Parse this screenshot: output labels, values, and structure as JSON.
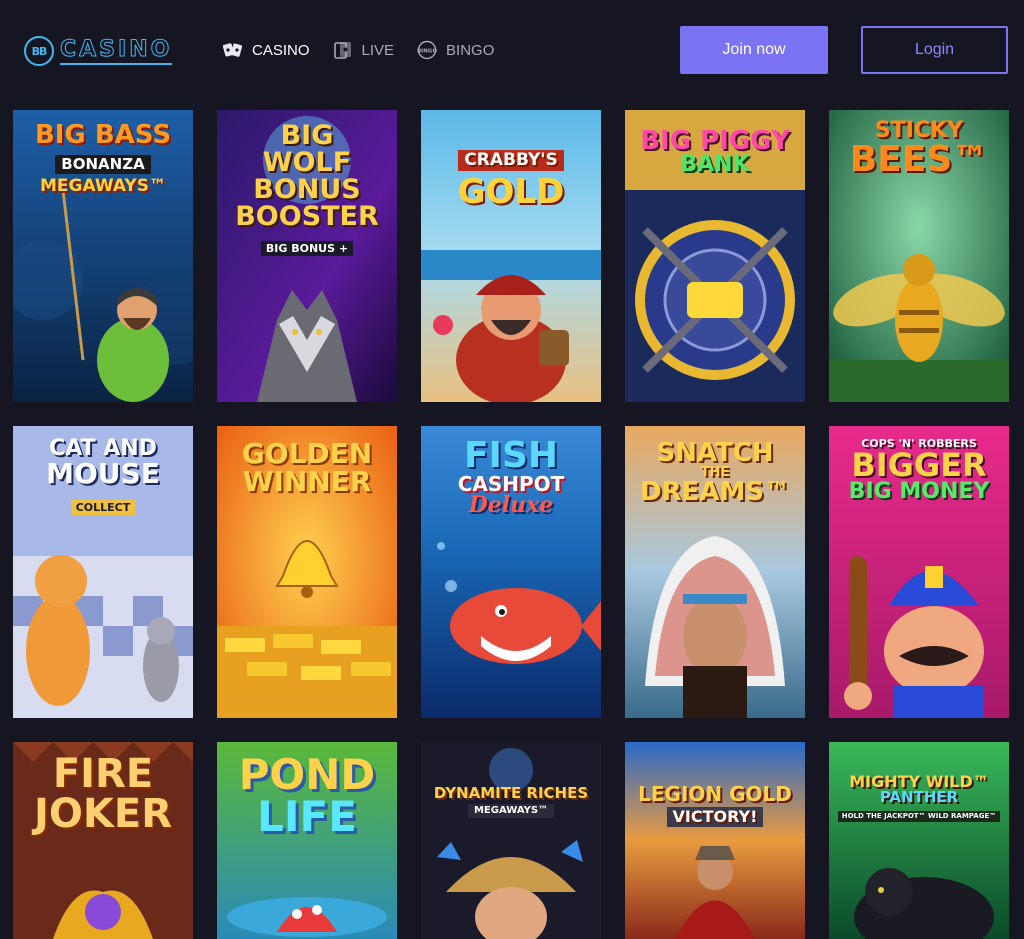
{
  "header": {
    "logo": {
      "badge": "BB",
      "text": "CASINO"
    },
    "nav": [
      {
        "label": "CASINO",
        "icon": "cards-icon",
        "active": true
      },
      {
        "label": "LIVE",
        "icon": "live-cards-icon",
        "active": false
      },
      {
        "label": "BINGO",
        "icon": "bingo-ball-icon",
        "active": false
      }
    ],
    "join_label": "Join now",
    "login_label": "Login"
  },
  "games": [
    {
      "lines": [
        "BIG BASS",
        "BONANZA",
        "MEGAWAYS™"
      ]
    },
    {
      "lines": [
        "BIG",
        "WOLF",
        "BONUS",
        "BOOSTER",
        "BIG BONUS +"
      ]
    },
    {
      "lines": [
        "CRABBY'S",
        "GOLD"
      ]
    },
    {
      "lines": [
        "BIG PIGGY",
        "BANK"
      ]
    },
    {
      "lines": [
        "STICKY",
        "BEES™"
      ]
    },
    {
      "lines": [
        "CAT AND",
        "MOUSE",
        "COLLECT"
      ]
    },
    {
      "lines": [
        "GOLDEN",
        "WINNER"
      ]
    },
    {
      "lines": [
        "FISH",
        "CASHPOT",
        "Deluxe"
      ]
    },
    {
      "lines": [
        "SNATCH",
        "THE",
        "DREAMS™"
      ]
    },
    {
      "lines": [
        "COPS 'N' ROBBERS",
        "BIGGER",
        "BIG MONEY"
      ]
    },
    {
      "lines": [
        "FIRE",
        "JOKER"
      ]
    },
    {
      "lines": [
        "POND",
        "LIFE"
      ]
    },
    {
      "lines": [
        "DYNAMITE RICHES",
        "MEGAWAYS™"
      ]
    },
    {
      "lines": [
        "LEGION GOLD",
        "VICTORY!"
      ]
    },
    {
      "lines": [
        "MIGHTY WILD™",
        "PANTHER",
        "HOLD THE JACKPOT™ WILD RAMPAGE™"
      ]
    }
  ]
}
